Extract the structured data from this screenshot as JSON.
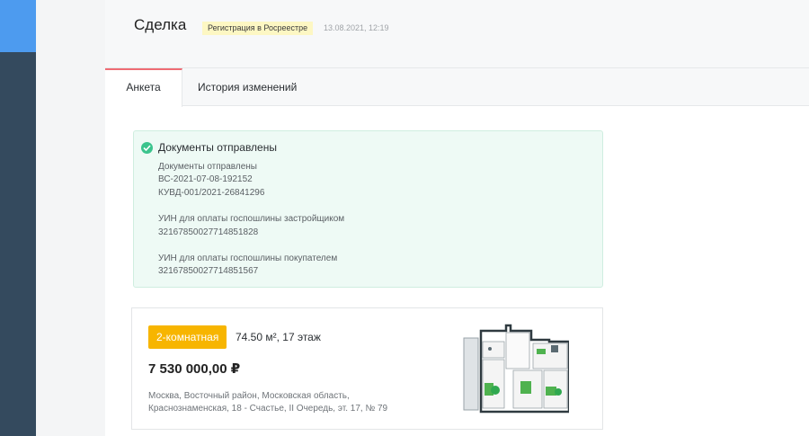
{
  "header": {
    "title": "Сделка",
    "status": "Регистрация в Росреестре",
    "date": "13.08.2021, 12:19"
  },
  "tabs": [
    {
      "label": "Анкета"
    },
    {
      "label": "История изменений"
    }
  ],
  "documents": {
    "title": "Документы отправлены",
    "lines": [
      "Документы отправлены",
      "ВС-2021-07-08-192152",
      "КУВД-001/2021-26841296",
      "",
      "УИН для оплаты госпошлины застройщиком",
      "32167850027714851828",
      "",
      "УИН для оплаты госпошлины покупателем",
      "32167850027714851567"
    ]
  },
  "apartment": {
    "rooms": "2-комнатная",
    "area_floor": "74.50 м², 17 этаж",
    "price": "7 530 000,00 ₽",
    "address_line1": "Москва, Восточный район, Московская область,",
    "address_line2": "Краснознаменская, 18 - Счастье, II Очередь, эт. 17, № 79"
  },
  "colors": {
    "sidebar": "#344a5e",
    "sidebar_accent": "#4d9bef",
    "tab_active_border": "#ef6c74",
    "success": "#3bc48d",
    "rooms_badge": "#f7b500",
    "status_badge": "#fdf7c3"
  }
}
